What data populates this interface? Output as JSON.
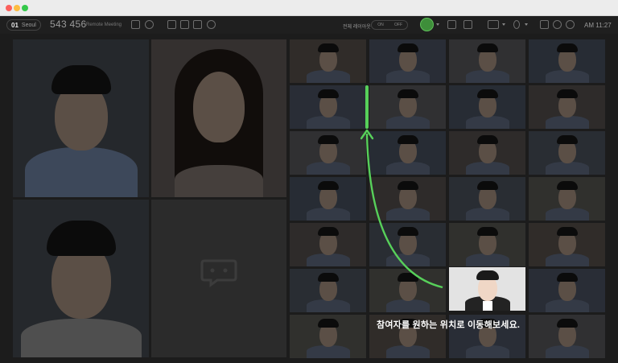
{
  "window": {
    "controls": [
      "close",
      "minimize",
      "zoom"
    ]
  },
  "toolbar": {
    "room_number": "01",
    "room_name": "Seoul",
    "meeting_code": "543 456",
    "meeting_title": "Remote Meeting",
    "layout_select": "전체 레이아웃",
    "toggle_on": "ON",
    "toggle_off": "OFF",
    "clock": "AM 11:27",
    "icons": [
      "lock-icon",
      "participant-icon",
      "screen-share-icon",
      "document-icon",
      "camera-snapshot-icon",
      "record-icon",
      "user-avatar-icon",
      "layout-icon",
      "notes-icon",
      "video-camera-icon",
      "microphone-icon",
      "fullscreen-icon",
      "settings-icon",
      "exit-icon"
    ]
  },
  "grid": {
    "large_tiles": 4,
    "small_columns": 4,
    "small_rows": 7
  },
  "instruction": {
    "text": "참여자를 원하는 위치로 이동해보세요."
  },
  "colors": {
    "arrow": "#57d05a",
    "background": "#1c1c1c",
    "highlight_tile": "#e3e3e3"
  }
}
